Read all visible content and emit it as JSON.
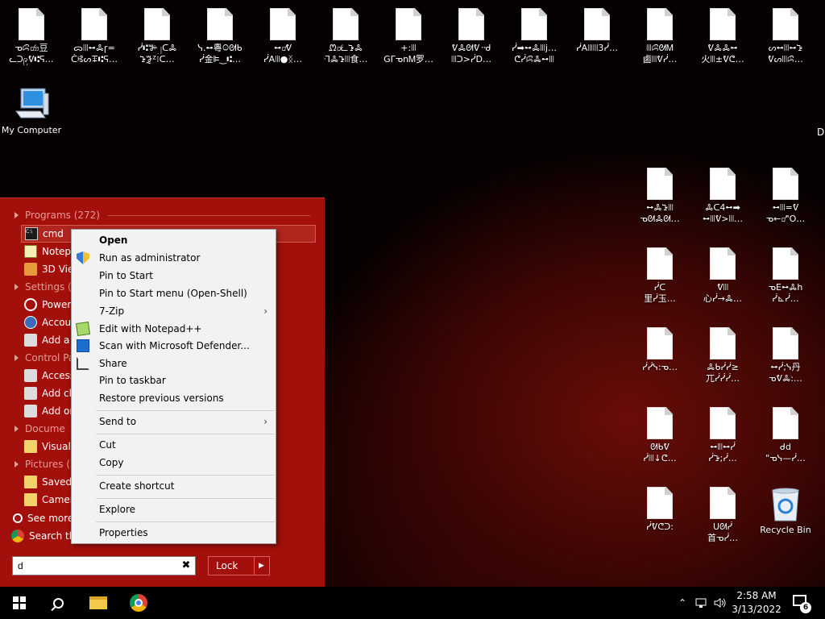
{
  "desktop": {
    "top_row": [
      {
        "line1": "ᓀꕸ꩸ꤤ豆",
        "line2": "ᓚᑐ၉ᕓ⑆ᕋ…"
      },
      {
        "line1": "ᯅꔖꕹꔆꞅ=",
        "line2": "ᑖꕙᔕꔊ⑆ᕋ…"
      },
      {
        "line1": "ᓰ⑆ꔑ၂ᑕꔆ",
        "line2": "ꕲꖄᙆ⁝ᑕ…"
      },
      {
        "line1": "ᓭ.ꕹ粵ꖴᘛᑲ",
        "line2": "ᓰ金ꕞ‿⑆…"
      },
      {
        "line1": "ꕹ꩸ᕓ",
        "line2": "ᓰAꔖ●ᛝ…"
      },
      {
        "line1": "ᘻ꩸ᓚꕲꔆ",
        "line2": "ᒬꔆꕲꔖ食…"
      },
      {
        "line1": "+:ꔖ",
        "line2": "GᒥᓀnᎷ罗…"
      },
      {
        "line1": "ᕓꔆᘛᕓ᠃ᑯ",
        "line2": "ꔖᑐ>ᓰD…"
      },
      {
        "line1": "ᓰ➡ꕹꔆꔖj…",
        "line2": "ᕦᓰꕸꔆꕹꔖ"
      },
      {
        "line1": "ᓰAꔖꔖ3ᓰ…",
        "line2": ""
      },
      {
        "line1": "ꔖꕸᘛᎷ",
        "line2": "鹵ꔖᕓᓰ…"
      },
      {
        "line1": "ᕓꔆꔆꕹ",
        "line2": "火ꔖ±ᕓᕦ…"
      },
      {
        "line1": "ᔕꕹꔖꕹꕲ",
        "line2": "ᕓᔕꔖꕸ…"
      }
    ],
    "my_computer_label": "My Computer",
    "edge_label": "D",
    "grid_icons": [
      {
        "line1": "ꕹꔆꕲꔖ",
        "line2": "ᓀᘛꔆᘛ…"
      },
      {
        "line1": "ꔆᑕ4ꕹ➡",
        "line2": "ꕹꔖᕓ>ꔖ…"
      },
      {
        "line1": "ꕹꔖ=ᕓ",
        "line2": "ᓀ←꩸\"O…"
      },
      {
        "line1": "ᓰᑕ",
        "line2": "里ᓰ玉…"
      },
      {
        "line1": "ᕓꔖ",
        "line2": "心ᓰ→ꔆ…"
      },
      {
        "line1": "ᓀEꕹꔆh",
        "line2": "ᓰ⊾ᓰ…"
      },
      {
        "line1": "ᓰᓰᓭ:ᓀ…",
        "line2": ""
      },
      {
        "line1": "ꔆᑲᓰᓰ≥",
        "line2": "兀ᓰᓰᓰ…"
      },
      {
        "line1": "ꕹᓰ;ᓭ丹",
        "line2": "ᓀᕓꔆ:…"
      },
      {
        "line1": "ᘛᑲᕓ",
        "line2": "ᓰꔖ↓ᕦ…"
      },
      {
        "line1": "ꕹꔖꕹᓰ",
        "line2": "ᓰꕲ;ᓰ…"
      },
      {
        "line1": "ᑯd",
        "line2": "\"ᓀᓭ—ᓰ…"
      },
      {
        "line1": "ᓰᕓᕦᑐ:",
        "line2": ""
      },
      {
        "line1": "ᑌᘛᓰ",
        "line2": "首ᓀᓰ…"
      },
      {
        "line1": "Recycle Bin",
        "line2": ""
      }
    ]
  },
  "start_menu": {
    "programs_header": "Programs (272)",
    "cmd": "cmd",
    "notepad": "Notepa",
    "view3d": "3D View",
    "settings_header": "Settings (7",
    "power": "Power &",
    "accounts": "Accoun",
    "add_b": "Add a b",
    "control_header": "Control Pa",
    "access": "Access",
    "add_clo": "Add clo",
    "add_or": "Add or",
    "documents_header": "Docume",
    "visual_s": "Visual S",
    "pictures_header": "Pictures (2",
    "saved_p": "Saved P",
    "camera": "Camera",
    "see_more": "See more r",
    "search_the": "Search the",
    "search_value": "d",
    "lock_label": "Lock"
  },
  "context_menu": {
    "open": "Open",
    "run_admin": "Run as administrator",
    "pin_start": "Pin to Start",
    "pin_start_menu": "Pin to Start menu (Open-Shell)",
    "seven_zip": "7-Zip",
    "edit_notepad": "Edit with Notepad++",
    "scan_defender": "Scan with Microsoft Defender...",
    "share": "Share",
    "pin_taskbar": "Pin to taskbar",
    "restore": "Restore previous versions",
    "send_to": "Send to",
    "cut": "Cut",
    "copy": "Copy",
    "create_shortcut": "Create shortcut",
    "explore": "Explore",
    "properties": "Properties"
  },
  "taskbar": {
    "time": "2:58 AM",
    "date": "3/13/2022",
    "notification_count": "6"
  },
  "colors": {
    "start_menu_bg": "#a30f0a",
    "context_menu_bg": "#f2f2f2",
    "taskbar_bg": "#000000"
  }
}
